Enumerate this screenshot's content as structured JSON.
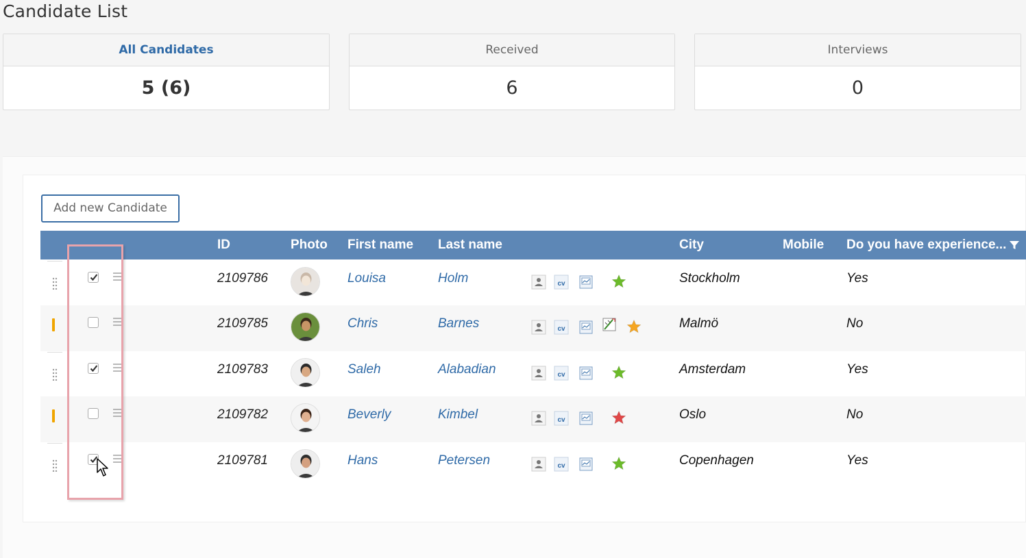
{
  "page": {
    "title": "Candidate List"
  },
  "stats": [
    {
      "label": "All Candidates",
      "value": "5 (6)",
      "active": true
    },
    {
      "label": "Received",
      "value": "6",
      "active": false
    },
    {
      "label": "Interviews",
      "value": "0",
      "active": false
    }
  ],
  "toolbar": {
    "add_label": "Add new Candidate"
  },
  "grid": {
    "columns": {
      "id": "ID",
      "photo": "Photo",
      "first": "First name",
      "last": "Last name",
      "city": "City",
      "mobile": "Mobile",
      "experience": "Do you have experience..."
    },
    "rows": [
      {
        "id": "2109786",
        "first": "Louisa",
        "last": "Holm",
        "city": "Stockholm",
        "experience": "Yes",
        "checked": true,
        "flag": false,
        "star": "green",
        "extra_icon": false
      },
      {
        "id": "2109785",
        "first": "Chris",
        "last": "Barnes",
        "city": "Malmö",
        "experience": "No",
        "checked": false,
        "flag": true,
        "star": "orange",
        "extra_icon": true
      },
      {
        "id": "2109783",
        "first": "Saleh",
        "last": "Alabadian",
        "city": "Amsterdam",
        "experience": "Yes",
        "checked": true,
        "flag": false,
        "star": "green",
        "extra_icon": false
      },
      {
        "id": "2109782",
        "first": "Beverly",
        "last": "Kimbel",
        "city": "Oslo",
        "experience": "No",
        "checked": false,
        "flag": true,
        "star": "red",
        "extra_icon": false
      },
      {
        "id": "2109781",
        "first": "Hans",
        "last": "Petersen",
        "city": "Copenhagen",
        "experience": "Yes",
        "checked": true,
        "flag": false,
        "star": "green",
        "extra_icon": false
      }
    ]
  },
  "colors": {
    "header_bg": "#5d87b6",
    "link": "#2f6aa7",
    "flag": "#f0a500",
    "star_green": "#6cbb2a",
    "star_orange": "#f5a623",
    "star_red": "#e04848",
    "highlight": "#e8a3ab"
  }
}
